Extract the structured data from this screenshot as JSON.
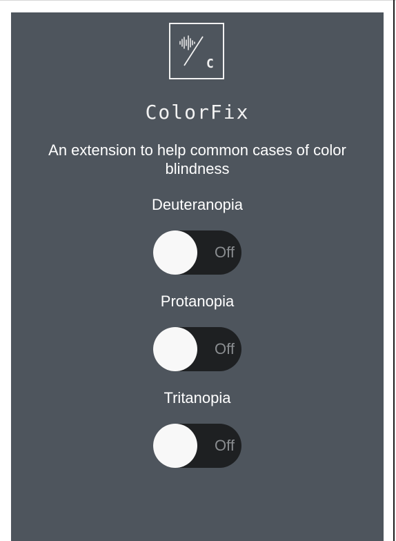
{
  "app": {
    "title": "ColorFix",
    "tagline": "An extension to help common cases of color blindness",
    "logo_icon": "soundwave-slash-c-icon",
    "logo_letter": "C"
  },
  "options": [
    {
      "label": "Deuteranopia",
      "state": "Off",
      "enabled": false
    },
    {
      "label": "Protanopia",
      "state": "Off",
      "enabled": false
    },
    {
      "label": "Tritanopia",
      "state": "Off",
      "enabled": false
    }
  ],
  "colors": {
    "panel": "#4e555d",
    "toggle_track": "#1e2022",
    "knob": "#f8f8f8",
    "text": "#ffffff",
    "state_text": "#8a8d90"
  }
}
